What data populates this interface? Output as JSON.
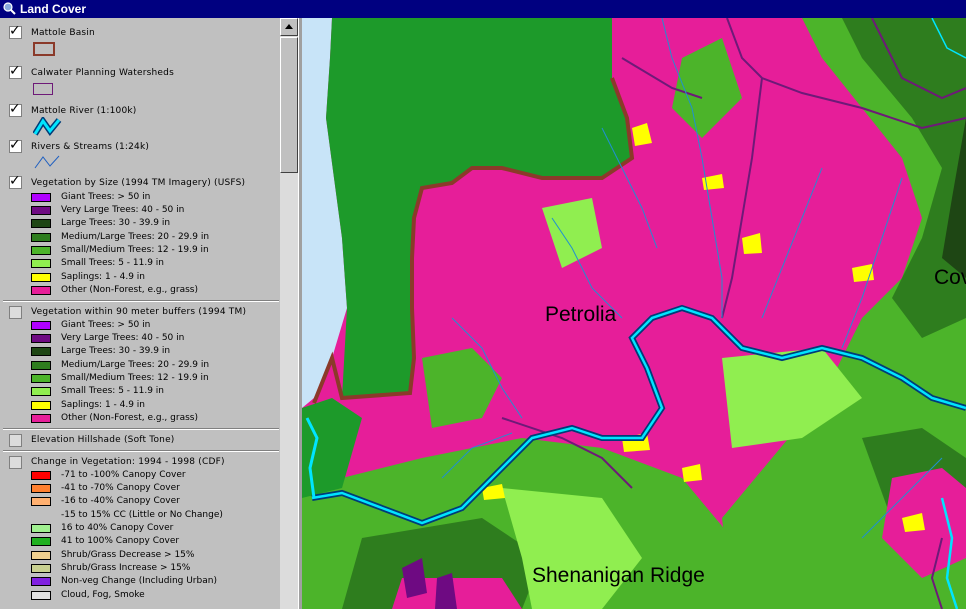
{
  "window": {
    "title": "Land Cover"
  },
  "toc": {
    "layers": [
      {
        "name": "Mattole Basin",
        "checked": true
      },
      {
        "name": "Calwater Planning Watersheds",
        "checked": true
      },
      {
        "name": "Mattole River (1:100k)",
        "checked": true
      },
      {
        "name": "Rivers & Streams (1:24k)",
        "checked": true
      },
      {
        "name": "Vegetation by Size (1994 TM Imagery) (USFS)",
        "checked": true
      },
      {
        "name": "Vegetation within 90 meter buffers (1994 TM)",
        "checked": false
      },
      {
        "name": "Elevation Hillshade (Soft Tone)",
        "checked": false
      },
      {
        "name": "Change in Vegetation: 1994 - 1998 (CDF)",
        "checked": false
      }
    ],
    "veg_classes": [
      {
        "label": "Giant Trees: > 50 in",
        "color": "#b000ff"
      },
      {
        "label": "Very Large Trees: 40 - 50 in",
        "color": "#6e0a82"
      },
      {
        "label": "Large Trees: 30 - 39.9 in",
        "color": "#1e4614"
      },
      {
        "label": "Medium/Large Trees: 20 - 29.9 in",
        "color": "#2e7d1e"
      },
      {
        "label": "Small/Medium Trees: 12 - 19.9 in",
        "color": "#4cb42a"
      },
      {
        "label": "Small Trees: 5 - 11.9 in",
        "color": "#90ee50"
      },
      {
        "label": "Saplings: 1 - 4.9 in",
        "color": "#ffff00"
      },
      {
        "label": "Other (Non-Forest, e.g., grass)",
        "color": "#e61e99"
      }
    ],
    "change_classes": [
      {
        "label": "-71 to -100% Canopy Cover",
        "color": "#ff0000"
      },
      {
        "label": "-41 to -70% Canopy Cover",
        "color": "#ff8030"
      },
      {
        "label": "-16 to -40% Canopy Cover",
        "color": "#ffb070"
      },
      {
        "label": "-15 to 15% CC (Little or No Change)",
        "color": "#c0c0c0"
      },
      {
        "label": "16 to 40% Canopy Cover",
        "color": "#a0f090"
      },
      {
        "label": "41 to 100% Canopy Cover",
        "color": "#20b020"
      },
      {
        "label": "Shrub/Grass Decrease > 15%",
        "color": "#f0d090"
      },
      {
        "label": "Shrub/Grass Increase > 15%",
        "color": "#c8d090"
      },
      {
        "label": "Non-veg Change (Including Urban)",
        "color": "#8020e0"
      },
      {
        "label": "Cloud, Fog, Smoke",
        "color": "#e0e0e0"
      }
    ]
  },
  "map": {
    "labels": {
      "petrolia": "Petrolia",
      "ridge": "Shenanigan Ridge",
      "cov": "Cov"
    }
  },
  "colors": {
    "title_bar": "#000080",
    "basin_outline": "#8b3a2a",
    "watershed_outline": "#6e1a78",
    "river": "#00e5ff",
    "ocean": "#c8e4f8"
  }
}
